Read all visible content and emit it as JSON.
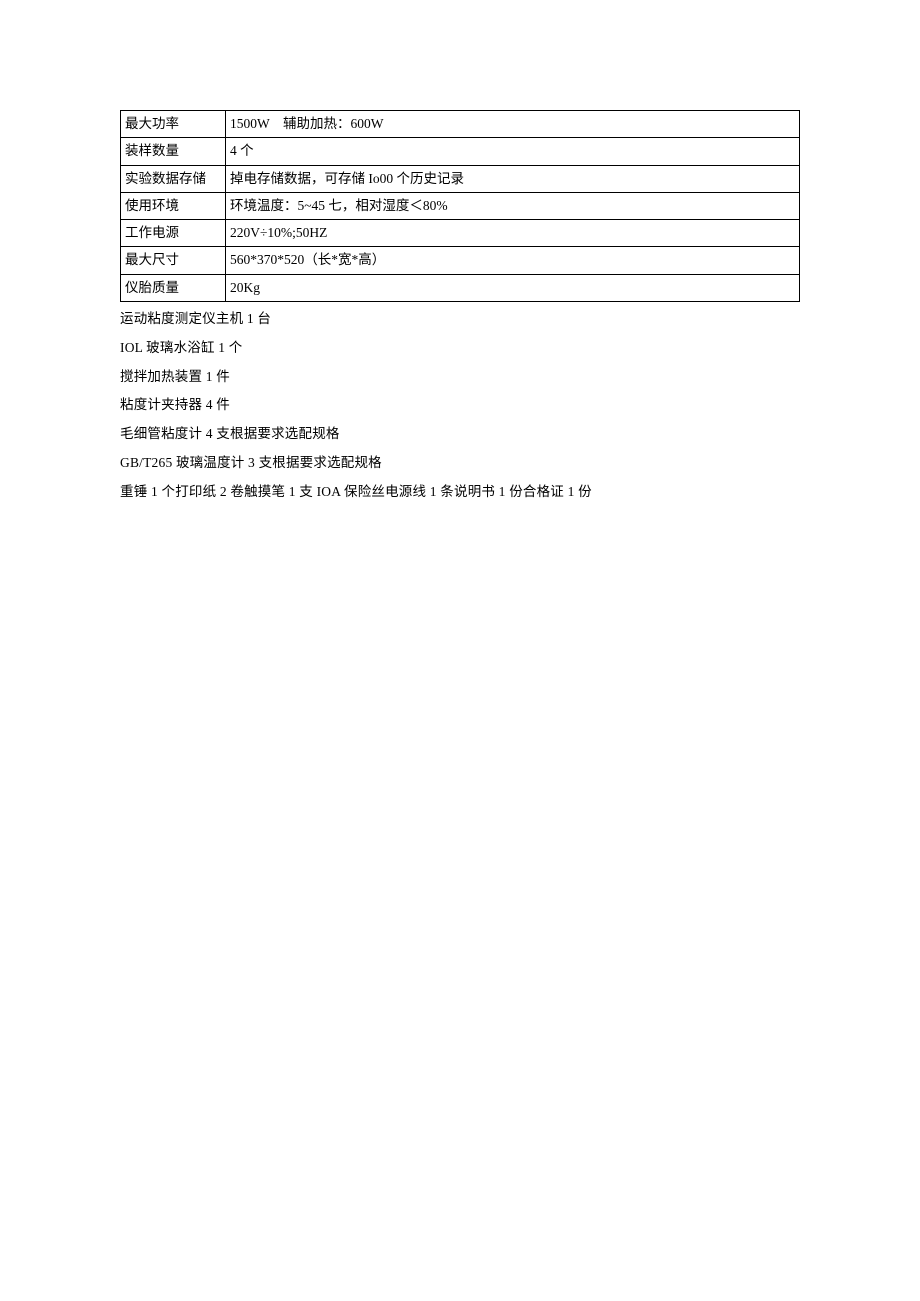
{
  "table": {
    "rows": [
      {
        "label": "最大功率",
        "value": "1500W　辅助加热：600W"
      },
      {
        "label": "装样数量",
        "value": "4 个"
      },
      {
        "label": "实验数据存储",
        "value": "掉电存储数据，可存储 Io00 个历史记录"
      },
      {
        "label": "使用环境",
        "value": "环境温度：5~45 七，相对湿度＜80%"
      },
      {
        "label": "工作电源",
        "value": "220V÷10%;50HZ"
      },
      {
        "label": "最大尺寸",
        "value": "560*370*520（长*宽*高）"
      },
      {
        "label": "仪胎质量",
        "value": "20Kg"
      }
    ]
  },
  "list": [
    "运动粘度测定仪主机 1 台",
    "IOL 玻璃水浴缸 1 个",
    "搅拌加热装置 1 件",
    "粘度计夹持器 4 件",
    "毛细管粘度计 4 支根据要求选配规格",
    "GB/T265 玻璃温度计 3 支根据要求选配规格",
    "重锤 1 个打印纸 2 卷触摸笔 1 支 IOA 保险丝电源线 1 条说明书 1 份合格证 1 份"
  ]
}
